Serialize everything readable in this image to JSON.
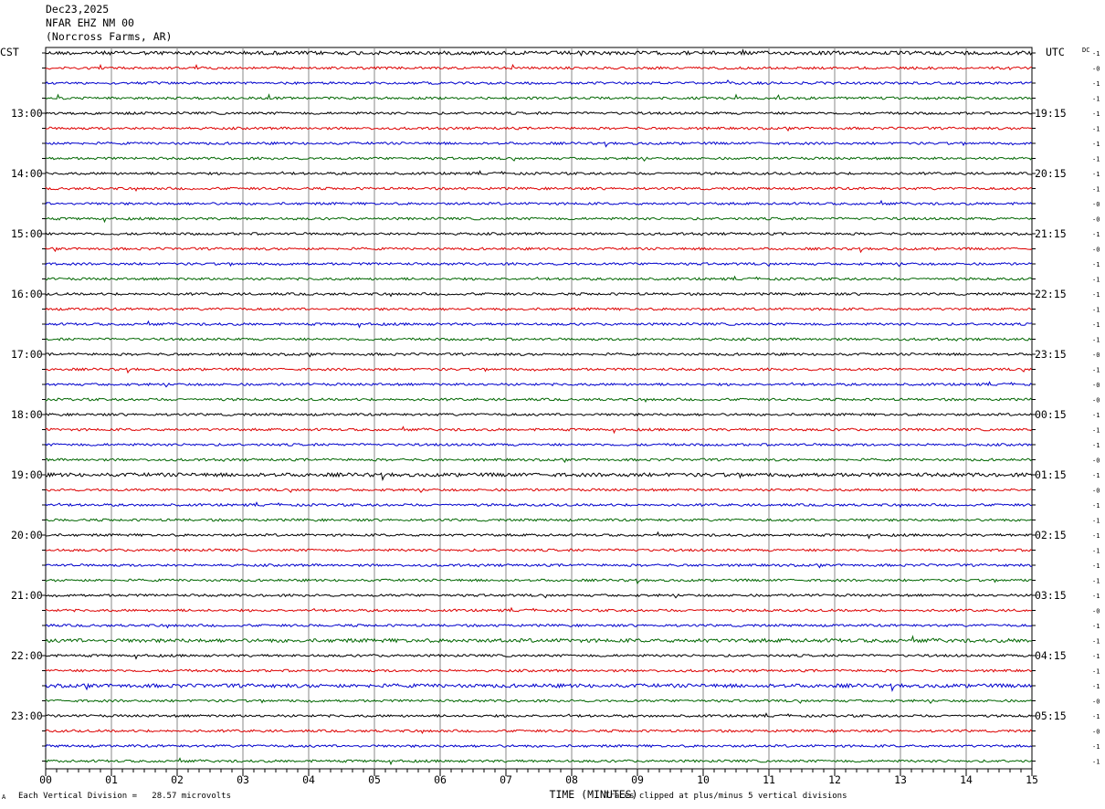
{
  "header": {
    "date": "Dec23,2025",
    "station": "NFAR EHZ NM 00",
    "location": "(Norcross Farms, AR)"
  },
  "left_tz": "CST",
  "right_tz": "UTC",
  "dc_label": "DC",
  "footer": {
    "scale": "Each Vertical Division =   28.57 microvolts",
    "clip": "Traces clipped at plus/minus 5 vertical divisions",
    "mark": "A"
  },
  "chart_data": {
    "type": "line",
    "title": "",
    "xlabel": "TIME (MINUTES)",
    "xlim": [
      0,
      15
    ],
    "x_ticks": [
      "00",
      "01",
      "02",
      "03",
      "04",
      "05",
      "06",
      "07",
      "08",
      "09",
      "10",
      "11",
      "12",
      "13",
      "14",
      "15"
    ],
    "left_time_labels": [
      "13:00",
      "14:00",
      "15:00",
      "16:00",
      "17:00",
      "18:00",
      "19:00",
      "20:00",
      "21:00",
      "22:00",
      "23:00"
    ],
    "right_time_labels": [
      "19:15",
      "20:15",
      "21:15",
      "22:15",
      "23:15",
      "00:15",
      "01:15",
      "02:15",
      "03:15",
      "04:15",
      "05:15"
    ],
    "label_first_row": 4,
    "label_every_rows": 4,
    "trace_colors": [
      "#000000",
      "#dd0000",
      "#0000cc",
      "#006600"
    ],
    "trace_count": 48,
    "dc_offsets": [
      "-1",
      "-0",
      "-1",
      "-1",
      "-1",
      "-1",
      "-1",
      "-1",
      "-1",
      "-1",
      "-0",
      "-0",
      "-1",
      "-0",
      "-1",
      "-1",
      "-1",
      "-1",
      "-1",
      "-1",
      "-0",
      "-1",
      "-0",
      "-0",
      "-1",
      "-1",
      "-1",
      "-0",
      "-1",
      "-0",
      "-1",
      "-1",
      "-1",
      "-1",
      "-1",
      "-1",
      "-1",
      "-0",
      "-1",
      "-1",
      "-1",
      "-1",
      "-1",
      "-0",
      "-1",
      "-0",
      "-1",
      "-1"
    ],
    "trace_noise_level": [
      3,
      2,
      2,
      2,
      2,
      2,
      2,
      2,
      2,
      2,
      2,
      2,
      2,
      2,
      2,
      2,
      2,
      2,
      2,
      2,
      2,
      2,
      2,
      2,
      2,
      2,
      2,
      2,
      3,
      2,
      2,
      2,
      2,
      2,
      2,
      2,
      2,
      2,
      2,
      3,
      2,
      2,
      3,
      2,
      2,
      2,
      2,
      2
    ]
  }
}
